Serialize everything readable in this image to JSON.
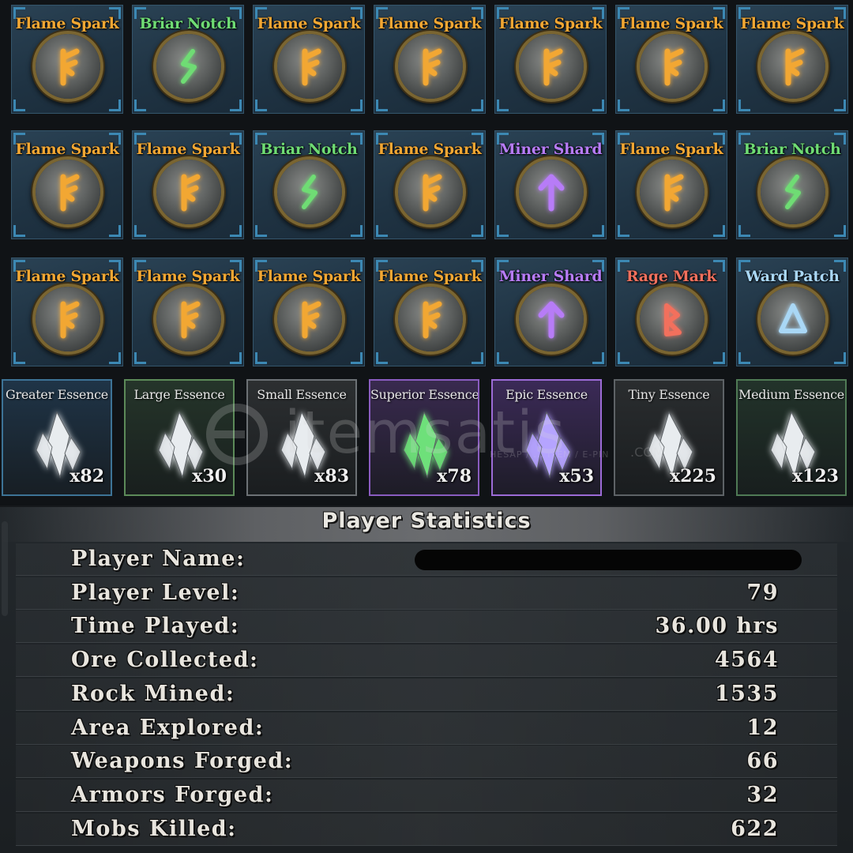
{
  "colors": {
    "flame": "#f2a733",
    "briar": "#6fdc74",
    "miner": "#b77cf7",
    "rage": "#f2705d",
    "ward": "#a9d7f5"
  },
  "runes": [
    {
      "name": "Flame Spark",
      "kind": "flame",
      "icon": "flame-rune-icon"
    },
    {
      "name": "Briar Notch",
      "kind": "briar",
      "icon": "briar-rune-icon"
    },
    {
      "name": "Flame Spark",
      "kind": "flame",
      "icon": "flame-rune-icon"
    },
    {
      "name": "Flame Spark",
      "kind": "flame",
      "icon": "flame-rune-icon"
    },
    {
      "name": "Flame Spark",
      "kind": "flame",
      "icon": "flame-rune-icon"
    },
    {
      "name": "Flame Spark",
      "kind": "flame",
      "icon": "flame-rune-icon"
    },
    {
      "name": "Flame Spark",
      "kind": "flame",
      "icon": "flame-rune-icon"
    },
    {
      "name": "Flame Spark",
      "kind": "flame",
      "icon": "flame-rune-icon"
    },
    {
      "name": "Flame Spark",
      "kind": "flame",
      "icon": "flame-rune-icon"
    },
    {
      "name": "Briar Notch",
      "kind": "briar",
      "icon": "briar-rune-icon"
    },
    {
      "name": "Flame Spark",
      "kind": "flame",
      "icon": "flame-rune-icon"
    },
    {
      "name": "Miner Shard",
      "kind": "miner",
      "icon": "miner-rune-icon"
    },
    {
      "name": "Flame Spark",
      "kind": "flame",
      "icon": "flame-rune-icon"
    },
    {
      "name": "Briar Notch",
      "kind": "briar",
      "icon": "briar-rune-icon"
    },
    {
      "name": "Flame Spark",
      "kind": "flame",
      "icon": "flame-rune-icon"
    },
    {
      "name": "Flame Spark",
      "kind": "flame",
      "icon": "flame-rune-icon"
    },
    {
      "name": "Flame Spark",
      "kind": "flame",
      "icon": "flame-rune-icon"
    },
    {
      "name": "Flame Spark",
      "kind": "flame",
      "icon": "flame-rune-icon"
    },
    {
      "name": "Miner Shard",
      "kind": "miner",
      "icon": "miner-rune-icon"
    },
    {
      "name": "Rage Mark",
      "kind": "rage",
      "icon": "rage-rune-icon"
    },
    {
      "name": "Ward Patch",
      "kind": "ward",
      "icon": "ward-rune-icon"
    }
  ],
  "essences": [
    {
      "name": "Greater Essence",
      "count": "x82",
      "tier": "greater",
      "bg": "#1f3447",
      "border": "#3d7396",
      "crystal": "#e8ecef"
    },
    {
      "name": "Large Essence",
      "count": "x30",
      "tier": "large",
      "bg": "#25352a",
      "border": "#5c8a59",
      "crystal": "#e8ecef"
    },
    {
      "name": "Small Essence",
      "count": "x83",
      "tier": "small",
      "bg": "#2c2f31",
      "border": "#6c7175",
      "crystal": "#e8ecef"
    },
    {
      "name": "Superior Essence",
      "count": "x78",
      "tier": "superior",
      "bg": "#392a4f",
      "border": "#8a5cc0",
      "crystal": "#6ee07a"
    },
    {
      "name": "Epic Essence",
      "count": "x53",
      "tier": "epic",
      "bg": "#3b2a57",
      "border": "#9c6bd6",
      "crystal": "#b5a4ff"
    },
    {
      "name": "Tiny Essence",
      "count": "x225",
      "tier": "tiny",
      "bg": "#2a2d2f",
      "border": "#5d6266",
      "crystal": "#e8ecef"
    },
    {
      "name": "Medium Essence",
      "count": "x123",
      "tier": "medium",
      "bg": "#22332a",
      "border": "#4f7a55",
      "crystal": "#e8ecef"
    }
  ],
  "watermark": {
    "text": "itemsatis",
    "tagline": "HESAP / ... ITEM / E-PIN",
    "domain": ".COM"
  },
  "stats": {
    "title": "Player Statistics",
    "rows": [
      {
        "label": "Player Name:",
        "value": ""
      },
      {
        "label": "Player Level:",
        "value": "79"
      },
      {
        "label": "Time Played:",
        "value": "36.00 hrs"
      },
      {
        "label": "Ore Collected:",
        "value": "4564"
      },
      {
        "label": "Rock Mined:",
        "value": "1535"
      },
      {
        "label": "Area Explored:",
        "value": "12"
      },
      {
        "label": "Weapons Forged:",
        "value": "66"
      },
      {
        "label": "Armors Forged:",
        "value": "32"
      },
      {
        "label": "Mobs Killed:",
        "value": "622"
      }
    ]
  }
}
